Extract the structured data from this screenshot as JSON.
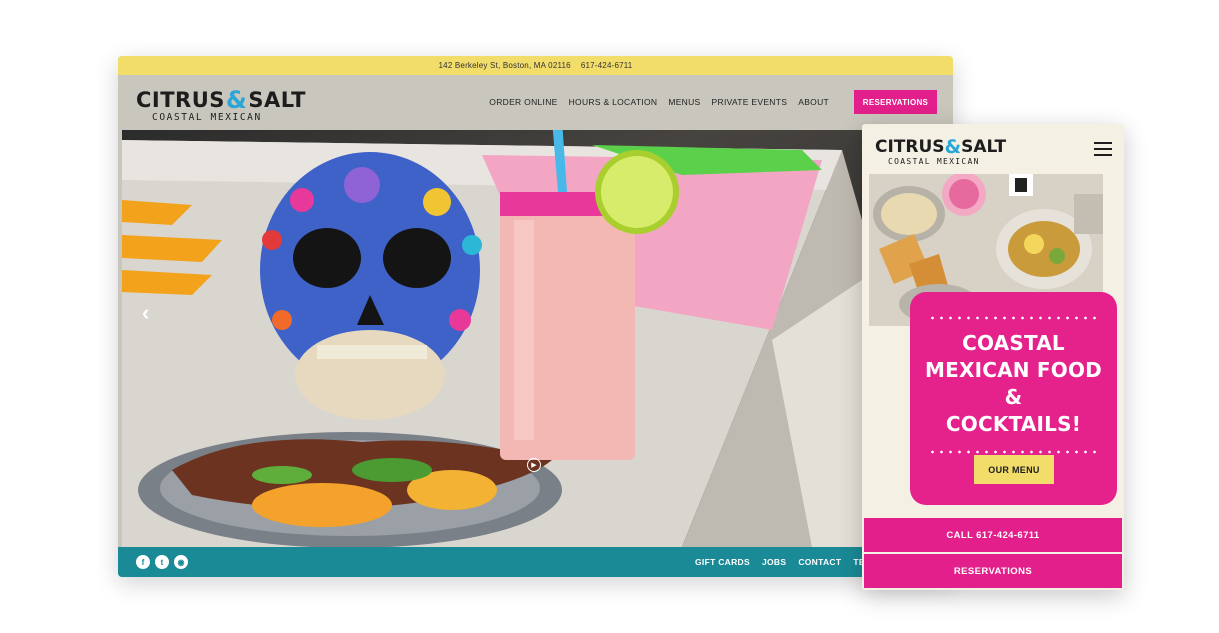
{
  "topbar": {
    "address": "142 Berkeley St, Boston, MA 02116",
    "phone": "617-424-6711"
  },
  "brand": {
    "name_left": "CITRUS",
    "ampersand": "&",
    "name_right": "SALT",
    "tagline": "COASTAL MEXICAN"
  },
  "nav": {
    "items": [
      {
        "label": "ORDER ONLINE"
      },
      {
        "label": "HOURS & LOCATION"
      },
      {
        "label": "MENUS"
      },
      {
        "label": "PRIVATE EVENTS"
      },
      {
        "label": "ABOUT"
      }
    ],
    "reservations": "RESERVATIONS"
  },
  "hero": {
    "prev_icon": "chevron-left-icon",
    "play_icon": "play-icon"
  },
  "footer": {
    "social": [
      "facebook-icon",
      "twitter-icon",
      "instagram-icon"
    ],
    "links": [
      {
        "label": "GIFT CARDS"
      },
      {
        "label": "JOBS"
      },
      {
        "label": "CONTACT"
      },
      {
        "label": "TEAM"
      }
    ]
  },
  "mobile": {
    "menu_icon": "hamburger-icon",
    "headline_1": "COASTAL",
    "headline_2": "MEXICAN FOOD &",
    "headline_3": "COCKTAILS!",
    "menu_button": "OUR MENU",
    "call": "CALL 617-424-6711",
    "reservations": "RESERVATIONS"
  },
  "colors": {
    "yellow": "#f2dc6a",
    "pink": "#e21f8a",
    "teal": "#1a8a96",
    "blue": "#2aa7d9",
    "cream": "#f4f0e4"
  }
}
